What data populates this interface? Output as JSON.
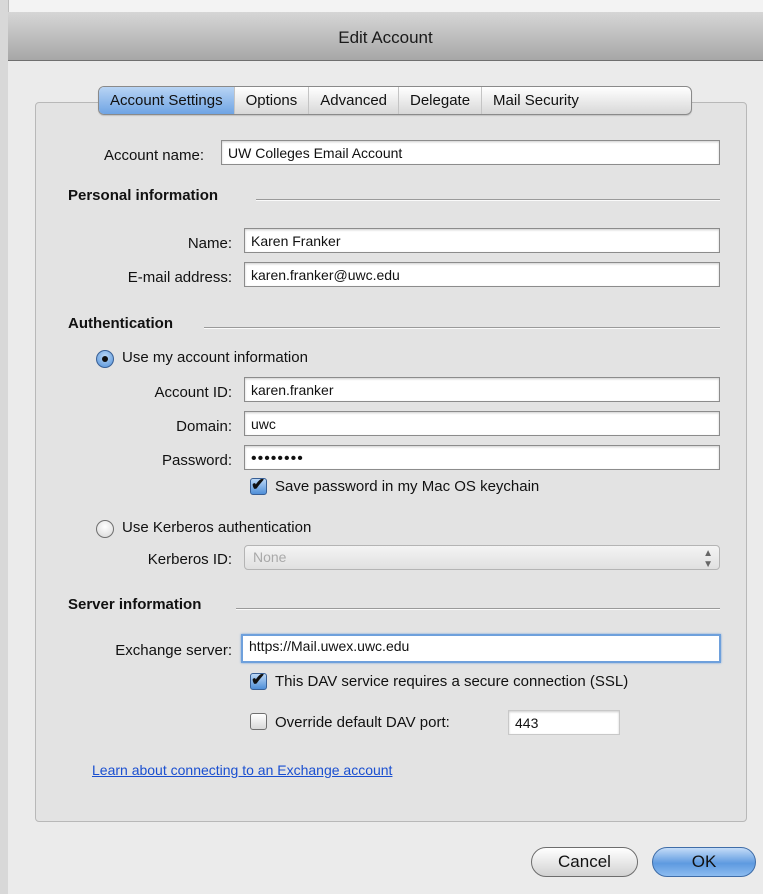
{
  "window": {
    "title": "Edit Account"
  },
  "tabs": [
    {
      "label": "Account Settings",
      "active": true
    },
    {
      "label": "Options",
      "active": false
    },
    {
      "label": "Advanced",
      "active": false
    },
    {
      "label": "Delegate",
      "active": false
    },
    {
      "label": "Mail Security",
      "active": false
    }
  ],
  "account": {
    "label": "Account name:",
    "value": "UW Colleges Email Account"
  },
  "personal": {
    "heading": "Personal information",
    "name_label": "Name:",
    "name_value": "Karen Franker",
    "email_label": "E-mail address:",
    "email_value": "karen.franker@uwc.edu"
  },
  "auth": {
    "heading": "Authentication",
    "use_account_label": "Use my account information",
    "use_account_selected": true,
    "account_id_label": "Account ID:",
    "account_id_value": "karen.franker",
    "domain_label": "Domain:",
    "domain_value": "uwc",
    "password_label": "Password:",
    "password_value": "••••••••",
    "save_password_label": "Save password in my Mac OS keychain",
    "save_password_checked": true,
    "kerberos_label": "Use Kerberos authentication",
    "kerberos_selected": false,
    "kerberos_id_label": "Kerberos ID:",
    "kerberos_id_value": "None"
  },
  "server": {
    "heading": "Server information",
    "exchange_label": "Exchange server:",
    "exchange_value": "https://Mail.uwex.uwc.edu",
    "ssl_label": "This DAV service requires a secure connection (SSL)",
    "ssl_checked": true,
    "override_label": "Override default DAV port:",
    "override_checked": false,
    "port_value": "443"
  },
  "help_link": "Learn about connecting to an Exchange account",
  "buttons": {
    "cancel": "Cancel",
    "ok": "OK"
  },
  "colors": {
    "accent": "#5e9ae0",
    "link": "#1a4fd0"
  }
}
